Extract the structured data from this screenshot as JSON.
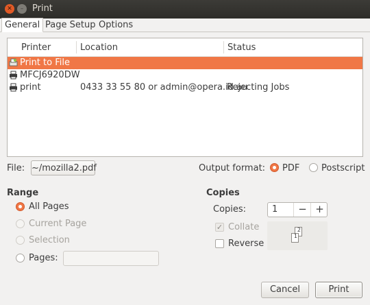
{
  "window": {
    "title": "Print",
    "close_glyph": "✕",
    "minimize_glyph": "–"
  },
  "tabs": [
    {
      "label": "General",
      "active": true
    },
    {
      "label": "Page Setup",
      "active": false
    },
    {
      "label": "Options",
      "active": false
    }
  ],
  "printer_list": {
    "columns": [
      "Printer",
      "Location",
      "Status"
    ],
    "rows": [
      {
        "icon": "print-to-file-icon",
        "printer": "Print to File",
        "location": "",
        "status": "",
        "selected": true
      },
      {
        "icon": "printer-icon",
        "printer": "MFCJ6920DW",
        "location": "",
        "status": "",
        "selected": false
      },
      {
        "icon": "printer-icon",
        "printer": "print",
        "location": "0433 33 55 80 or admin@opera.id.au",
        "status": "Rejecting Jobs",
        "selected": false
      }
    ]
  },
  "file": {
    "label": "File:",
    "value": "~/mozilla2.pdf"
  },
  "output_format": {
    "label": "Output format:",
    "options": [
      "PDF",
      "Postscript"
    ],
    "selected": "PDF"
  },
  "range": {
    "heading": "Range",
    "all_pages": "All Pages",
    "current_page": "Current Page",
    "selection": "Selection",
    "pages": "Pages:",
    "pages_value": "",
    "selected": "All Pages"
  },
  "copies": {
    "heading": "Copies",
    "label": "Copies:",
    "value": "1",
    "decrement": "−",
    "increment": "+",
    "collate": "Collate",
    "collate_checked": true,
    "collate_enabled": false,
    "reverse": "Reverse",
    "reverse_checked": false,
    "collate_art_pages": [
      "1",
      "2"
    ]
  },
  "buttons": {
    "cancel": "Cancel",
    "print": "Print"
  },
  "colors": {
    "accent": "#f07746",
    "titlebar": "#3c3b37"
  }
}
